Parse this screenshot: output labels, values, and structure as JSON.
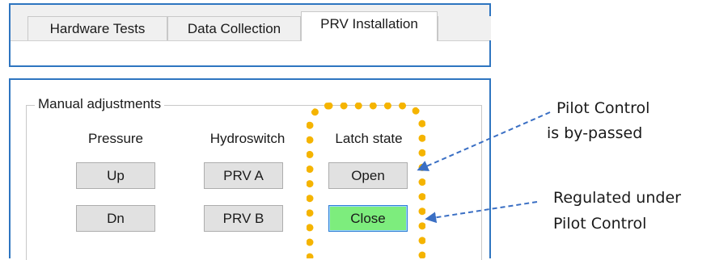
{
  "tabs": [
    {
      "label": "Hardware Tests",
      "active": false
    },
    {
      "label": "Data Collection",
      "active": false
    },
    {
      "label": "PRV Installation",
      "active": true
    }
  ],
  "group": {
    "title": "Manual adjustments",
    "columns": {
      "pressure": {
        "header": "Pressure",
        "buttons": [
          "Up",
          "Dn"
        ]
      },
      "hydroswitch": {
        "header": "Hydroswitch",
        "buttons": [
          "PRV A",
          "PRV B"
        ]
      },
      "latch": {
        "header": "Latch state",
        "buttons": [
          "Open",
          "Close"
        ],
        "active_button": "Close"
      }
    }
  },
  "annotations": {
    "pilot_bypassed": {
      "line1": "Pilot Control",
      "line2": "is by-passed"
    },
    "regulated": {
      "line1": "Regulated under",
      "line2": "Pilot Control"
    }
  },
  "colors": {
    "window_border": "#2e75c0",
    "active_button": "#7ded7d",
    "highlight": "#f5b400",
    "arrow": "#3a6fc4"
  }
}
